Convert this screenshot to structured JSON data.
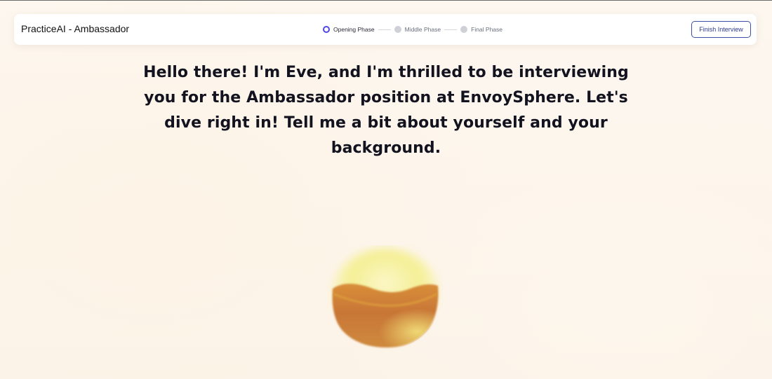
{
  "header": {
    "title": "PracticeAI - Ambassador",
    "phases": [
      {
        "label": "Opening Phase",
        "state": "active"
      },
      {
        "label": "Middle Phase",
        "state": "inactive"
      },
      {
        "label": "Final Phase",
        "state": "inactive"
      }
    ],
    "finish_button_label": "Finish Interview"
  },
  "main": {
    "message": "Hello there! I'm Eve, and I'm thrilled to be interviewing you for the Ambassador position at EnvoySphere. Let's dive right in! Tell me a bit about yourself and your background."
  },
  "colors": {
    "accent": "#4f46e5",
    "button_border": "#3b4fa8",
    "orb_top": "#f2ee8a",
    "orb_body": "#c97a36"
  }
}
